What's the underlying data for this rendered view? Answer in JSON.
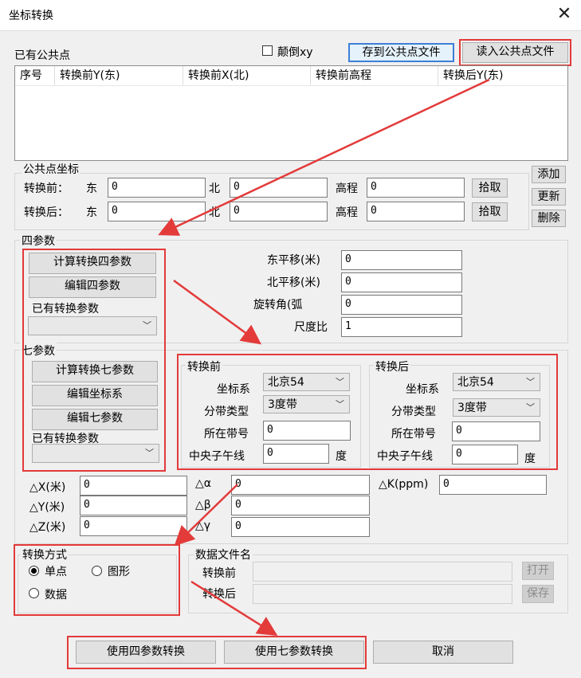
{
  "window": {
    "title": "坐标转换",
    "close": "✕"
  },
  "top": {
    "flip_xy": "颠倒xy",
    "save_common": "存到公共点文件",
    "load_common": "读入公共点文件"
  },
  "common_points": {
    "title": "已有公共点",
    "columns": [
      "序号",
      "转换前Y(东)",
      "转换前X(北)",
      "转换前高程",
      "转换后Y(东)"
    ]
  },
  "point_coords": {
    "title": "公共点坐标",
    "before_label": "转换前：",
    "after_label": "转换后：",
    "east": "东",
    "north": "北",
    "height": "高程",
    "before": {
      "east": "0",
      "north": "0",
      "height": "0"
    },
    "after": {
      "east": "0",
      "north": "0",
      "height": "0"
    },
    "pick": "拾取",
    "add": "添加",
    "update": "更新",
    "delete": "删除"
  },
  "four_param": {
    "title": "四参数",
    "calc": "计算转换四参数",
    "edit": "编辑四参数",
    "existing": "已有转换参数",
    "east_shift_label": "东平移(米)",
    "east_shift": "0",
    "north_shift_label": "北平移(米)",
    "north_shift": "0",
    "rotation_label": "旋转角(弧",
    "rotation": "0",
    "scale_label": "尺度比",
    "scale": "1"
  },
  "seven_param": {
    "title": "七参数",
    "calc": "计算转换七参数",
    "edit_coord": "编辑坐标系",
    "edit": "编辑七参数",
    "existing": "已有转换参数",
    "before": {
      "title": "转换前",
      "crs_label": "坐标系",
      "crs": "北京54",
      "zone_type_label": "分带类型",
      "zone_type": "3度带",
      "zone_no_label": "所在带号",
      "zone_no": "0",
      "meridian_label": "中央子午线",
      "meridian": "0",
      "deg": "度"
    },
    "after": {
      "title": "转换后",
      "crs_label": "坐标系",
      "crs": "北京54",
      "zone_type_label": "分带类型",
      "zone_type": "3度带",
      "zone_no_label": "所在带号",
      "zone_no": "0",
      "meridian_label": "中央子午线",
      "meridian": "0",
      "deg": "度"
    },
    "dx_label": "△X(米)",
    "dx": "0",
    "dy_label": "△Y(米)",
    "dy": "0",
    "dz_label": "△Z(米)",
    "dz": "0",
    "da_label": "△α",
    "da": "0",
    "db_label": "△β",
    "db": "0",
    "dg_label": "△γ",
    "dg": "0",
    "dk_label": "△K(ppm)",
    "dk": "0"
  },
  "mode": {
    "title": "转换方式",
    "single": "单点",
    "graphic": "图形",
    "data": "数据"
  },
  "data_file": {
    "title": "数据文件名",
    "before": "转换前",
    "after": "转换后",
    "open": "打开",
    "save": "保存"
  },
  "bottom": {
    "use_four": "使用四参数转换",
    "use_seven": "使用七参数转换",
    "cancel": "取消"
  }
}
